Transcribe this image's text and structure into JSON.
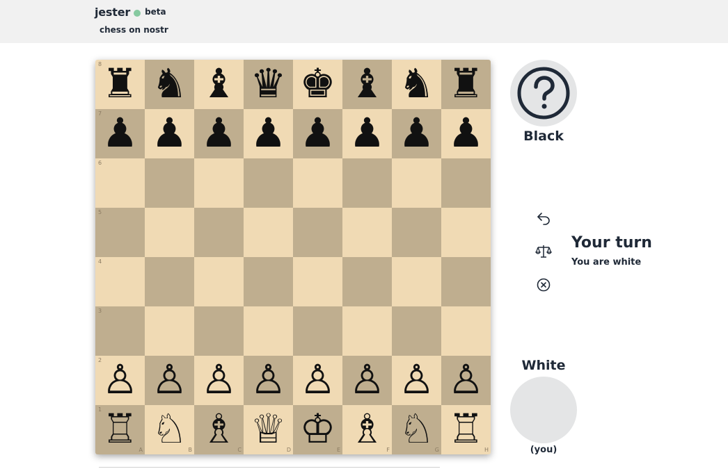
{
  "header": {
    "brand": "jester",
    "badge": "beta",
    "tagline": "chess on nostr",
    "status_color": "#86c9a0"
  },
  "board": {
    "light_color": "#f0dab4",
    "dark_color": "#bfae8f",
    "ranks": [
      "8",
      "7",
      "6",
      "5",
      "4",
      "3",
      "2",
      "1"
    ],
    "files": [
      "A",
      "B",
      "C",
      "D",
      "E",
      "F",
      "G",
      "H"
    ],
    "position": [
      [
        "♜",
        "♞",
        "♝",
        "♛",
        "♚",
        "♝",
        "♞",
        "♜"
      ],
      [
        "♟",
        "♟",
        "♟",
        "♟",
        "♟",
        "♟",
        "♟",
        "♟"
      ],
      [
        "",
        "",
        "",
        "",
        "",
        "",
        "",
        ""
      ],
      [
        "",
        "",
        "",
        "",
        "",
        "",
        "",
        ""
      ],
      [
        "",
        "",
        "",
        "",
        "",
        "",
        "",
        ""
      ],
      [
        "",
        "",
        "",
        "",
        "",
        "",
        "",
        ""
      ],
      [
        "♙",
        "♙",
        "♙",
        "♙",
        "♙",
        "♙",
        "♙",
        "♙"
      ],
      [
        "♖",
        "♘",
        "♗",
        "♕",
        "♔",
        "♗",
        "♘",
        "♖"
      ]
    ]
  },
  "opponent": {
    "name": "Black",
    "avatar_icon": "question-mark-icon"
  },
  "player": {
    "name": "White",
    "you_label": "(you)"
  },
  "actions": [
    {
      "name": "undo-button",
      "icon": "undo-arrow-icon"
    },
    {
      "name": "offer-draw-button",
      "icon": "scales-icon"
    },
    {
      "name": "resign-button",
      "icon": "circle-x-icon"
    }
  ],
  "turn": {
    "title": "Your turn",
    "subtitle": "You are white"
  }
}
